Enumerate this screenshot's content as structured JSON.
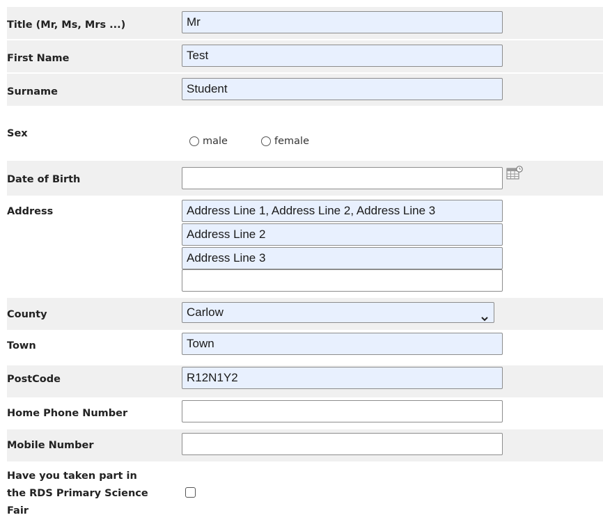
{
  "form": {
    "title": {
      "label": "Title (Mr, Ms, Mrs ...)",
      "value": "Mr"
    },
    "first_name": {
      "label": "First Name",
      "value": "Test"
    },
    "surname": {
      "label": "Surname",
      "value": "Student"
    },
    "sex": {
      "label": "Sex",
      "options": [
        "male",
        "female"
      ]
    },
    "dob": {
      "label": "Date of Birth",
      "value": "",
      "icon": "calendar-icon"
    },
    "address": {
      "label": "Address",
      "lines": [
        "Address Line 1, Address Line 2, Address Line 3",
        "Address Line 2",
        "Address Line 3",
        ""
      ]
    },
    "county": {
      "label": "County",
      "value": "Carlow"
    },
    "town": {
      "label": "Town",
      "value": "Town"
    },
    "postcode": {
      "label": "PostCode",
      "value": "R12N1Y2"
    },
    "home_phone": {
      "label": "Home Phone Number",
      "value": ""
    },
    "mobile": {
      "label": "Mobile Number",
      "value": ""
    },
    "rds_primary": {
      "label_lines": [
        "Have you taken part in",
        "the RDS Primary Science",
        "Fair"
      ],
      "checked": false
    }
  },
  "colors": {
    "row_shade": "#f0f0f0",
    "autofill": "#e8f0fe",
    "border": "#8c8c8c"
  }
}
